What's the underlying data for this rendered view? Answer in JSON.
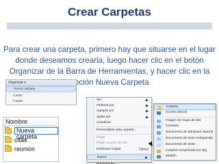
{
  "title": "Crear Carpetas",
  "body_text": "Para crear una carpeta, primero hay que situarse en el lugar donde deseamos crearla, luego hacer clic en el botón Organizar de la Barra de Herramientas, y hacer clic en la opción Nueva Carpeta",
  "organizar_menu": {
    "header": "Organizar ▾",
    "items": [
      "Nueva carpeta",
      "Cortar",
      "Copiar"
    ]
  },
  "explorer": {
    "column_header": "Nombre",
    "rows": [
      "Nueva carpeta",
      "citas",
      "reunion"
    ]
  },
  "context_menu": {
    "items": [
      {
        "label": "Ver",
        "submenu": true
      },
      {
        "label": "Ordenar por",
        "submenu": true
      },
      {
        "label": "Agrupar por",
        "submenu": true
      },
      {
        "label": "Apilar por",
        "submenu": true
      },
      {
        "label": "Actualizar",
        "submenu": false
      },
      {
        "sep": true
      },
      {
        "label": "Personalizar esta carpeta...",
        "submenu": false
      },
      {
        "sep": true
      },
      {
        "label": "Pegar",
        "dim": true
      },
      {
        "label": "Pegar acceso directo",
        "dim": true
      },
      {
        "label": "Deshacer Copiar",
        "shortcut": "Ctrl+Z"
      },
      {
        "sep": true
      },
      {
        "label": "Nuevo",
        "submenu": true,
        "highlight": true
      },
      {
        "sep": true
      },
      {
        "label": "Propiedades"
      }
    ]
  },
  "new_submenu": {
    "items": [
      {
        "label": "Carpeta",
        "highlight": true,
        "icon_color": "#f1c34b"
      },
      {
        "label": "Acceso directo",
        "icon_color": "#3a7bd5"
      },
      {
        "sep": true
      },
      {
        "label": "Imagen de mapa de bits",
        "icon_color": "#8ab6e8"
      },
      {
        "label": "Contacto",
        "icon_color": "#6aa6d8"
      },
      {
        "label": "Documento de Windows Journal",
        "icon_color": "#7d9fc9"
      },
      {
        "label": "Documento de texto enriquecido",
        "icon_color": "#b6c6dc"
      },
      {
        "label": "Documento de texto",
        "icon_color": "#d4d8de"
      },
      {
        "label": "Carpeta comprimida (en zip)",
        "icon_color": "#e2b445"
      },
      {
        "label": "Maletín",
        "icon_color": "#6f7f99"
      }
    ]
  },
  "colors": {
    "title": "#1f3864",
    "body_text": "#2e5597",
    "highlight": "#dbe8f8"
  }
}
